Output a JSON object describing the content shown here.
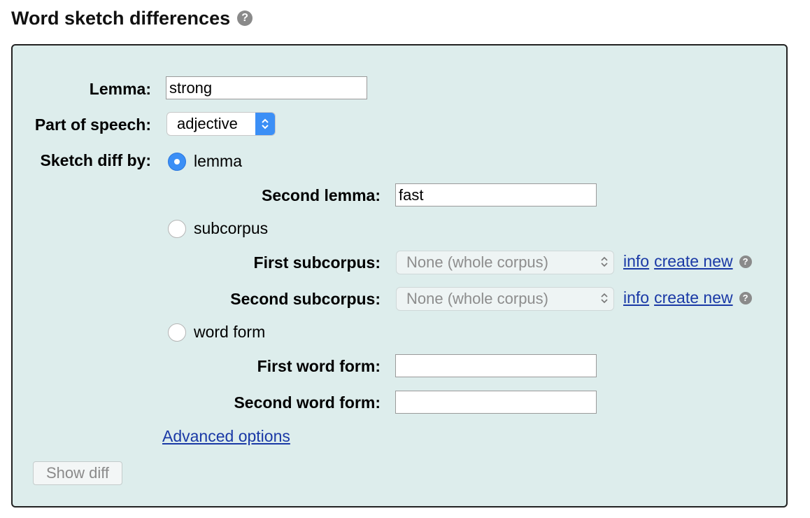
{
  "page": {
    "title": "Word sketch differences",
    "help_glyph": "?"
  },
  "form": {
    "lemma": {
      "label": "Lemma:",
      "value": "strong"
    },
    "pos": {
      "label": "Part of speech:",
      "value": "adjective"
    },
    "diff_by": {
      "label": "Sketch diff by:",
      "selected": "lemma",
      "options": {
        "lemma": "lemma",
        "subcorpus": "subcorpus",
        "word_form": "word form"
      }
    },
    "second_lemma": {
      "label": "Second lemma:",
      "value": "fast"
    },
    "first_subcorpus": {
      "label": "First subcorpus:",
      "value": "None (whole corpus)",
      "info_link": "info",
      "create_link": "create new"
    },
    "second_subcorpus": {
      "label": "Second subcorpus:",
      "value": "None (whole corpus)",
      "info_link": "info",
      "create_link": "create new"
    },
    "first_word_form": {
      "label": "First word form:",
      "value": ""
    },
    "second_word_form": {
      "label": "Second word form:",
      "value": ""
    },
    "advanced_link": "Advanced options",
    "submit_label": "Show diff"
  },
  "colors": {
    "panel_bg": "#ddedec",
    "accent": "#3b8ff6",
    "link": "#1a39a6"
  },
  "icons": {
    "help": "help-icon",
    "select_arrows": "chevron-up-down-icon"
  }
}
